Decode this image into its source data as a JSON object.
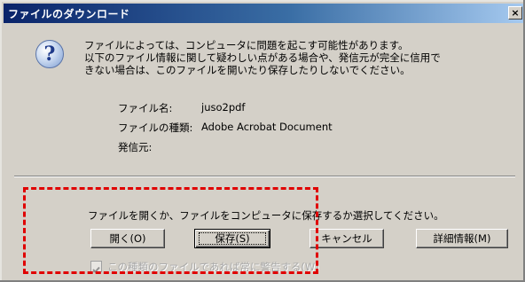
{
  "window": {
    "title": "ファイルのダウンロード",
    "close_label": "×"
  },
  "icons": {
    "dialog_icon": "question-icon",
    "dialog_icon_glyph": "?"
  },
  "warning": {
    "lines": [
      "ファイルによっては、コンピュータに問題を起こす可能性があります。",
      "以下のファイル情報に関して疑わしい点がある場合や、発信元が完全に信用で",
      "きない場合は、このファイルを開いたり保存したりしないでください。"
    ]
  },
  "file_info": {
    "name_label": "ファイル名:",
    "name_value": "juso2pdf",
    "type_label": "ファイルの種類:",
    "type_value": "Adobe Acrobat Document",
    "source_label": "発信元:",
    "source_value": ""
  },
  "prompt": "ファイルを開くか、ファイルをコンピュータに保存するか選択してください。",
  "buttons": {
    "open": "開く(O)",
    "save": "保存(S)",
    "cancel": "キャンセル",
    "details": "詳細情報(M)"
  },
  "checkbox": {
    "label": "この種類のファイルであれば常に警告する(W)",
    "checked": true,
    "enabled": false
  },
  "colors": {
    "highlight": "#e00000",
    "title_gradient_start": "#0a246a",
    "dialog_bg": "#d4d0c8"
  }
}
